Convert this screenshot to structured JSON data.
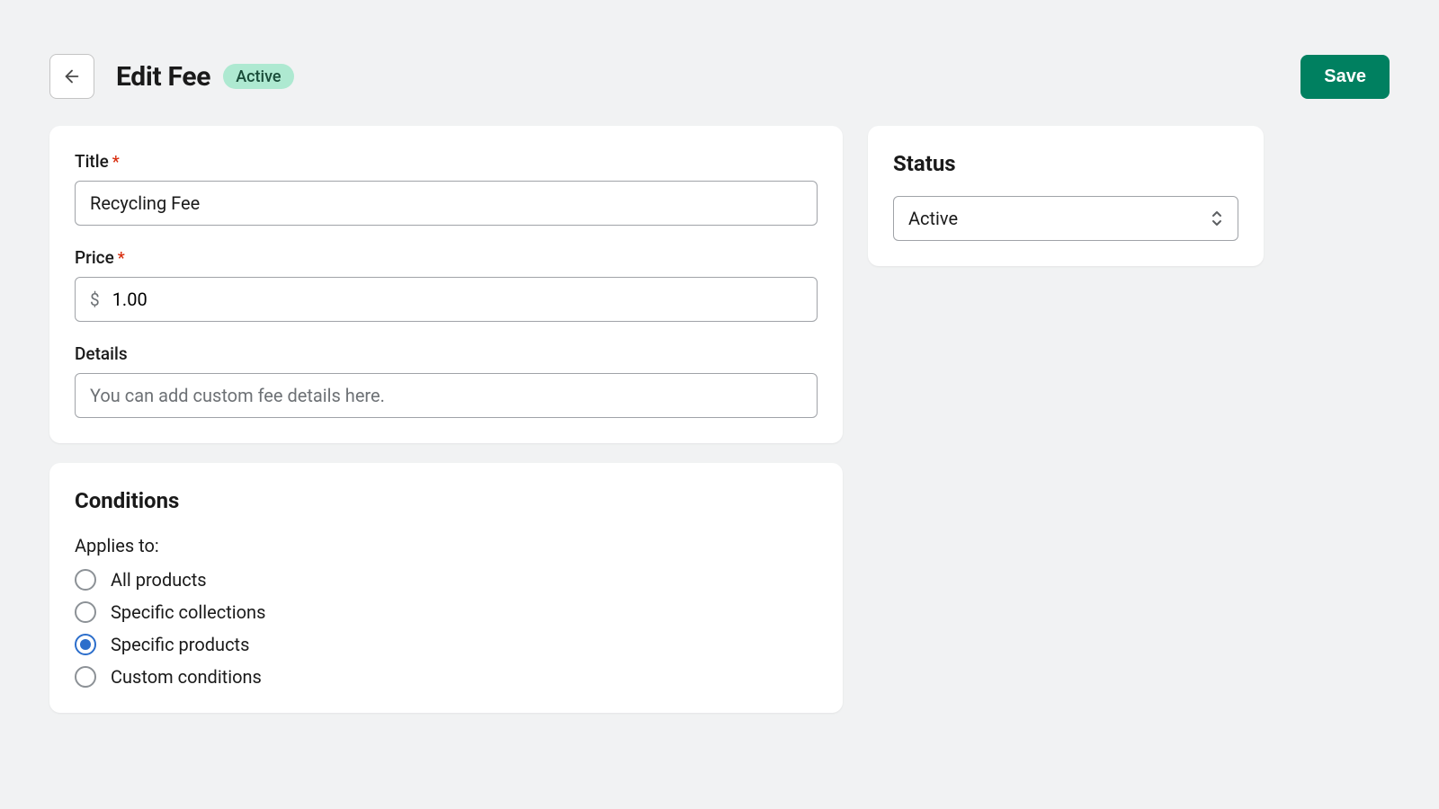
{
  "header": {
    "title": "Edit Fee",
    "badge": "Active",
    "save_label": "Save"
  },
  "form": {
    "title": {
      "label": "Title",
      "value": "Recycling Fee",
      "required": true
    },
    "price": {
      "label": "Price",
      "currency": "$",
      "value": "1.00",
      "required": true
    },
    "details": {
      "label": "Details",
      "placeholder": "You can add custom fee details here.",
      "value": ""
    }
  },
  "conditions": {
    "heading": "Conditions",
    "applies_to_label": "Applies to:",
    "options": [
      {
        "label": "All products",
        "selected": false
      },
      {
        "label": "Specific collections",
        "selected": false
      },
      {
        "label": "Specific products",
        "selected": true
      },
      {
        "label": "Custom conditions",
        "selected": false
      }
    ]
  },
  "status": {
    "heading": "Status",
    "value": "Active"
  }
}
